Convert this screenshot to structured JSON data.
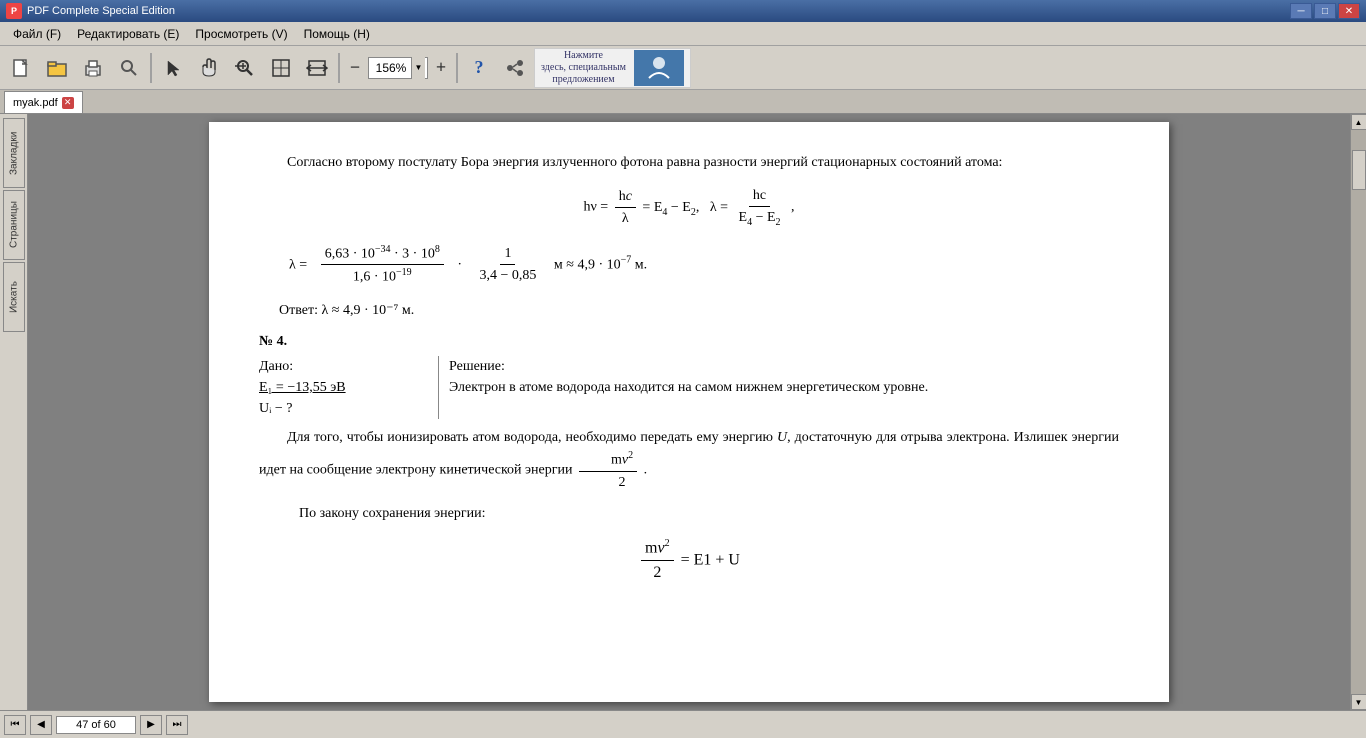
{
  "titlebar": {
    "title": "PDF Complete Special Edition",
    "min_label": "─",
    "max_label": "□",
    "close_label": "✕"
  },
  "menubar": {
    "items": [
      {
        "label": "Файл (F)"
      },
      {
        "label": "Редактировать (Е)"
      },
      {
        "label": "Просмотреть (V)"
      },
      {
        "label": "Помощь (Н)"
      }
    ]
  },
  "toolbar": {
    "zoom_value": "156%",
    "ad_text": "Нажмите здесь, специальным предложением"
  },
  "tabs": {
    "active_tab": "myak.pdf"
  },
  "side_tabs": [
    {
      "label": "Закладки"
    },
    {
      "label": "Страницы"
    },
    {
      "label": "Искать"
    }
  ],
  "pdf_content": {
    "para1": "Согласно второму постулату Бора энергия излученного фотона равна разности энергий стационарных состояний атома:",
    "answer": "Ответ: λ ≈ 4,9 · 10⁻⁷ м.",
    "problem_num": "№ 4.",
    "given_label": "Дано:",
    "given_e1": "E₁ = −13,55 эВ",
    "given_ui": "Uᵢ − ?",
    "solution_label": "Решение:",
    "solution_text1": "Электрон в атоме водорода находится на самом нижнем энергетическом уровне.",
    "solution_text2": "Для того, чтобы ионизировать атом водорода, необходимо передать ему энергию U, достаточную для отрыва электрона. Излишек энергии идет на сообщение электрону кинетической энергии",
    "solution_text3": "По закону сохранения энергии:"
  },
  "statusbar": {
    "page_info": "47 of 60"
  }
}
